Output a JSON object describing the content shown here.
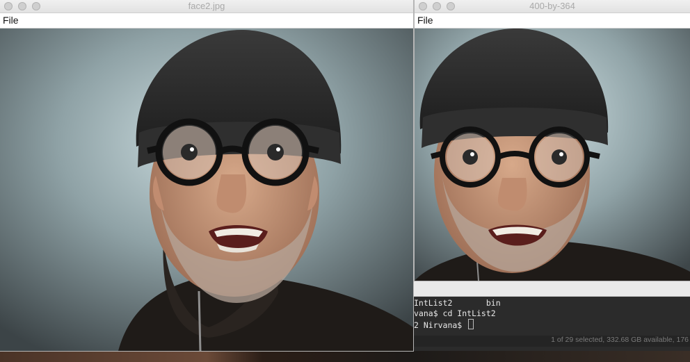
{
  "window_main": {
    "title": "face2.jpg",
    "menu": {
      "file_label": "File"
    }
  },
  "window_resized": {
    "title": "400-by-364",
    "menu": {
      "file_label": "File"
    }
  },
  "terminal": {
    "line1": "IntList2       bin",
    "line2": "vana$ cd IntList2",
    "line3": "2 Nirvana$ ",
    "finder_status": "1 of 29 selected, 332.68 GB available, 176"
  },
  "colors": {
    "background_grey": "#8c9ea3",
    "hat": "#2b2b2b",
    "skin": "#c99a7a",
    "jacket": "#1f1b18"
  }
}
